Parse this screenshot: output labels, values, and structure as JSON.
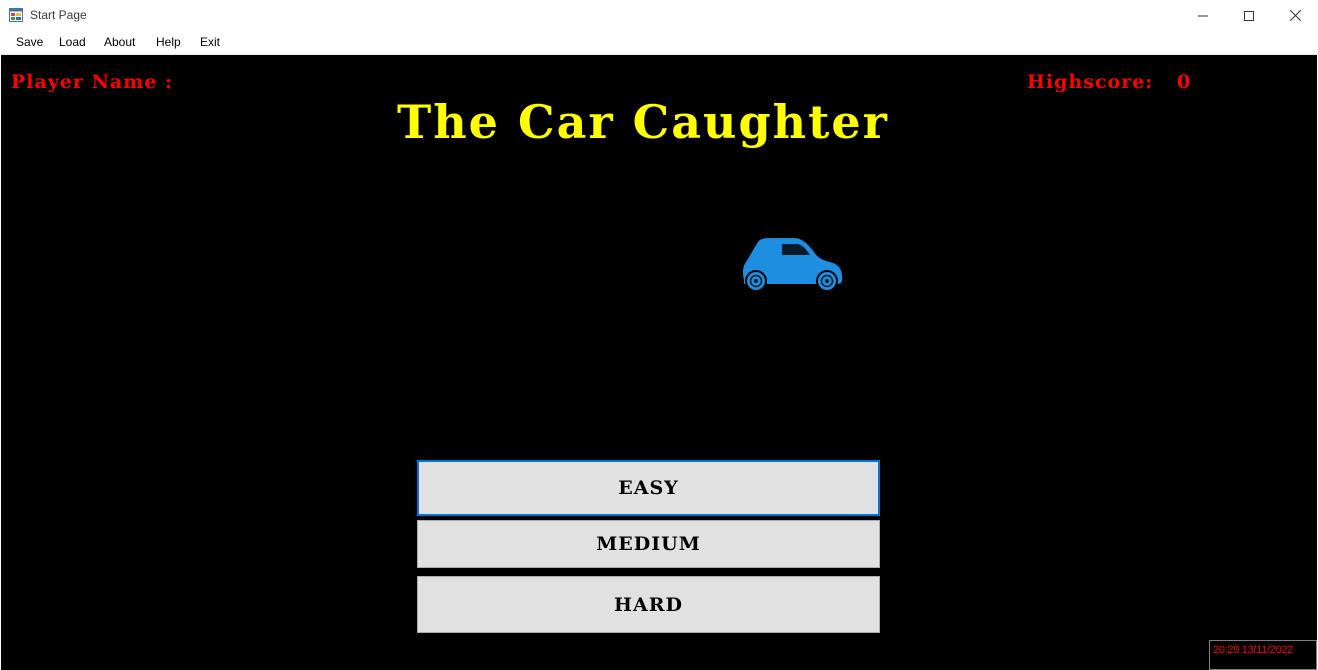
{
  "window": {
    "title": "Start Page"
  },
  "menu": {
    "items": [
      "Save",
      "Load",
      "About",
      "Help",
      "Exit"
    ]
  },
  "game": {
    "player_label": "Player Name :",
    "highscore_label": "Highscore:",
    "highscore_value": "0",
    "title": "The Car Caughter",
    "car_icon": "car-icon",
    "car_color": "#1e8fe0",
    "buttons": {
      "easy": "EASY",
      "medium": "MEDIUM",
      "hard": "HARD"
    },
    "clock": "20:29 13/11/2022"
  },
  "colors": {
    "background": "#000000",
    "label_red": "#ff0000",
    "title_yellow": "#ffff00",
    "button_face": "#e1e1e1",
    "focus_blue": "#0078d7"
  }
}
